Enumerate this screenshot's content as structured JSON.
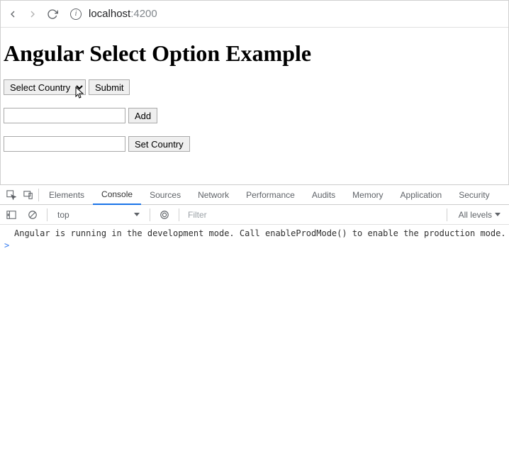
{
  "browser": {
    "url_host": "localhost",
    "url_port": ":4200"
  },
  "page": {
    "heading": "Angular Select Option Example",
    "select_placeholder": "Select Country",
    "submit_label": "Submit",
    "add_label": "Add",
    "set_country_label": "Set Country"
  },
  "devtools": {
    "tabs": {
      "elements": "Elements",
      "console": "Console",
      "sources": "Sources",
      "network": "Network",
      "performance": "Performance",
      "audits": "Audits",
      "memory": "Memory",
      "application": "Application",
      "security": "Security"
    },
    "context": "top",
    "filter_placeholder": "Filter",
    "levels_label": "All levels",
    "console_message": "Angular is running in the development mode. Call enableProdMode() to enable the production mode.",
    "prompt": ">"
  }
}
